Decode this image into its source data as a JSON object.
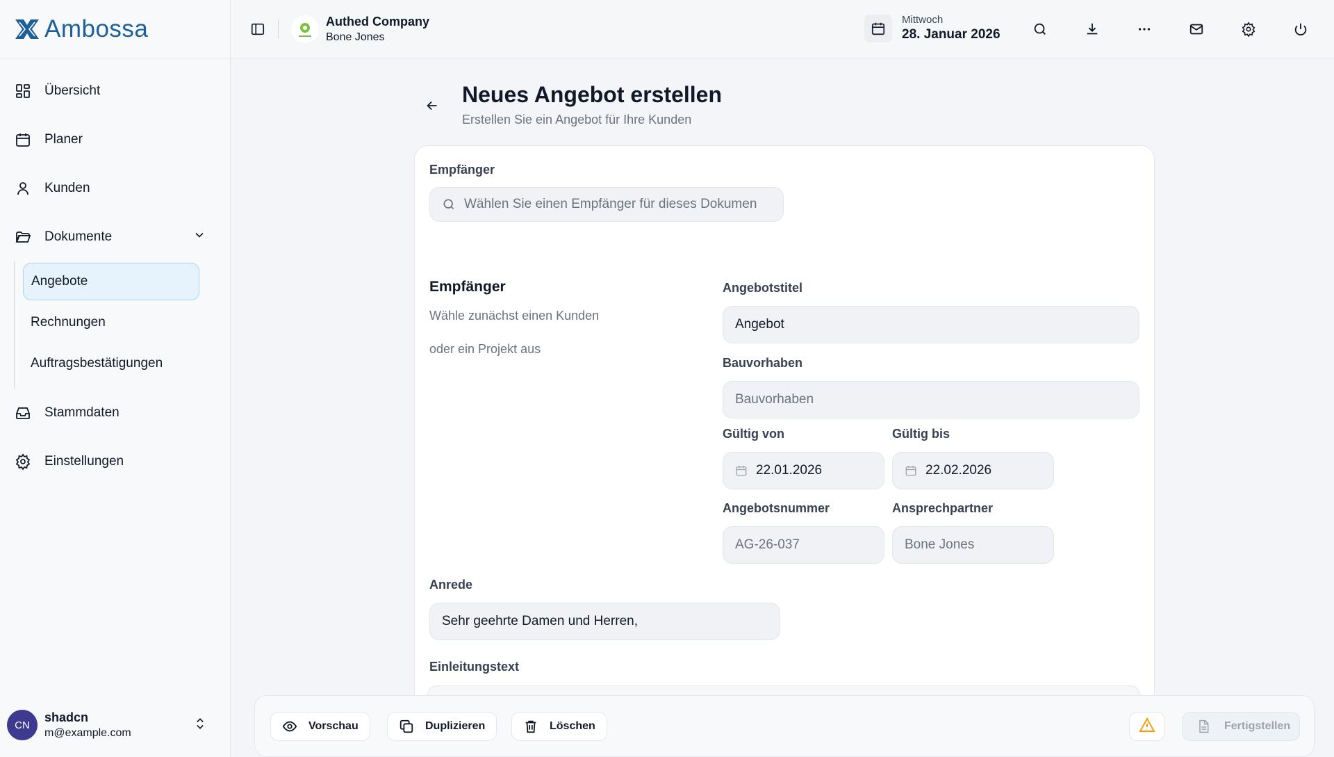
{
  "app": {
    "name": "Ambossa"
  },
  "sidebar": {
    "items": [
      {
        "label": "Übersicht",
        "icon": "dashboard-icon"
      },
      {
        "label": "Planer",
        "icon": "calendar-icon"
      },
      {
        "label": "Kunden",
        "icon": "user-icon"
      },
      {
        "label": "Dokumente",
        "icon": "folder-icon"
      },
      {
        "label": "Stammdaten",
        "icon": "inbox-icon"
      },
      {
        "label": "Einstellungen",
        "icon": "gear-icon"
      }
    ],
    "documents_sub": [
      "Angebote",
      "Rechnungen",
      "Auftragsbestätigungen"
    ],
    "active_sub": "Angebote"
  },
  "user": {
    "initials": "CN",
    "name": "shadcn",
    "email": "m@example.com"
  },
  "header": {
    "company": "Authed Company",
    "company_user": "Bone Jones",
    "weekday": "Mittwoch",
    "date": "28. Januar 2026"
  },
  "page": {
    "title": "Neues Angebot erstellen",
    "subtitle": "Erstellen Sie ein Angebot für Ihre Kunden"
  },
  "form": {
    "recipient_label": "Empfänger",
    "recipient_placeholder": "Wählen Sie einen Empfänger für dieses Dokumen",
    "section_title": "Empfänger",
    "section_text_1": "Wähle zunächst einen Kunden",
    "section_text_2": "oder ein Projekt aus",
    "offer_title_label": "Angebotstitel",
    "offer_title_value": "Angebot",
    "project_label": "Bauvorhaben",
    "project_placeholder": "Bauvorhaben",
    "valid_from_label": "Gültig von",
    "valid_from_value": "22.01.2026",
    "valid_to_label": "Gültig bis",
    "valid_to_value": "22.02.2026",
    "offer_number_label": "Angebotsnummer",
    "offer_number_value": "AG-26-037",
    "contact_label": "Ansprechpartner",
    "contact_value": "Bone Jones",
    "salutation_label": "Anrede",
    "salutation_value": "Sehr geehrte Damen und Herren,",
    "intro_label": "Einleitungstext"
  },
  "actions": {
    "preview": "Vorschau",
    "duplicate": "Duplizieren",
    "delete": "Löschen",
    "finish": "Fertigstellen"
  },
  "colors": {
    "brand": "#1d5f98",
    "active_bg": "#e6f3fc",
    "active_border": "#a8d4f5",
    "avatar": "#3e3a8f",
    "warning": "#f59e0b"
  }
}
